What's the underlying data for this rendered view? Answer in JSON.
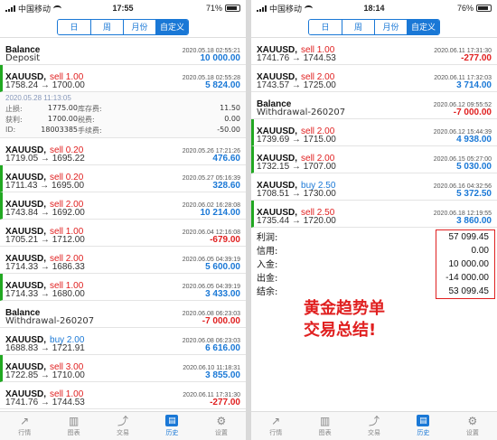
{
  "status_left": {
    "carrier": "中国移动",
    "time": "17:55",
    "battery": "71%",
    "battery_level": 0.71
  },
  "status_right": {
    "carrier": "中国移动",
    "time": "18:14",
    "battery": "76%",
    "battery_level": 0.76
  },
  "segments": [
    "日",
    "周",
    "月份",
    "自定义"
  ],
  "active_segment": "自定义",
  "left_rows": [
    {
      "kind": "balance",
      "title": "Balance",
      "date": "2020.05.18 02:55:21",
      "desc": "Deposit",
      "pl": "10 000.00",
      "sign": "pos",
      "mark": false
    },
    {
      "kind": "trade",
      "symbol": "XAUUSD,",
      "side": "sell",
      "lots": "sell 1.00",
      "date": "2020.05.18 02:55:28",
      "price": "1758.24 → 1700.00",
      "pl": "5 824.00",
      "sign": "pos",
      "mark": true
    },
    {
      "kind": "detail",
      "time": "2020.05.28 11:13:05",
      "items": [
        {
          "k": "止损:",
          "v": "1775.00",
          "k2": "库存费:",
          "v2": "11.50"
        },
        {
          "k": "获利:",
          "v": "1700.00",
          "k2": "税费:",
          "v2": "0.00"
        },
        {
          "k": "ID:",
          "v": "18003385",
          "k2": "手续费:",
          "v2": "-50.00"
        }
      ]
    },
    {
      "kind": "trade",
      "symbol": "XAUUSD,",
      "side": "sell",
      "lots": "sell 0.20",
      "date": "2020.05.26 17:21:26",
      "price": "1719.05 → 1695.22",
      "pl": "476.60",
      "sign": "pos",
      "mark": false
    },
    {
      "kind": "trade",
      "symbol": "XAUUSD,",
      "side": "sell",
      "lots": "sell 0.20",
      "date": "2020.05.27 05:16:39",
      "price": "1711.43 → 1695.00",
      "pl": "328.60",
      "sign": "pos",
      "mark": true
    },
    {
      "kind": "trade",
      "symbol": "XAUUSD,",
      "side": "sell",
      "lots": "sell 2.00",
      "date": "2020.06.02 16:28:08",
      "price": "1743.84 → 1692.00",
      "pl": "10 214.00",
      "sign": "pos",
      "mark": true
    },
    {
      "kind": "trade",
      "symbol": "XAUUSD,",
      "side": "sell",
      "lots": "sell 1.00",
      "date": "2020.06.04 12:16:08",
      "price": "1705.21 → 1712.00",
      "pl": "-679.00",
      "sign": "neg",
      "mark": false
    },
    {
      "kind": "trade",
      "symbol": "XAUUSD,",
      "side": "sell",
      "lots": "sell 2.00",
      "date": "2020.06.05 04:39:19",
      "price": "1714.33 → 1686.33",
      "pl": "5 600.00",
      "sign": "pos",
      "mark": false
    },
    {
      "kind": "trade",
      "symbol": "XAUUSD,",
      "side": "sell",
      "lots": "sell 1.00",
      "date": "2020.06.05 04:39:19",
      "price": "1714.33 → 1680.00",
      "pl": "3 433.00",
      "sign": "pos",
      "mark": true
    },
    {
      "kind": "balance",
      "title": "Balance",
      "date": "2020.06.08 06:23:03",
      "desc": "Withdrawal-260207",
      "pl": "-7 000.00",
      "sign": "neg",
      "mark": false
    },
    {
      "kind": "trade",
      "symbol": "XAUUSD,",
      "side": "buy",
      "lots": "buy 2.00",
      "date": "2020.06.08 06:23:03",
      "price": "1688.83 → 1721.91",
      "pl": "6 616.00",
      "sign": "pos",
      "mark": false
    },
    {
      "kind": "trade",
      "symbol": "XAUUSD,",
      "side": "sell",
      "lots": "sell 3.00",
      "date": "2020.06.10 11:18:31",
      "price": "1722.85 → 1710.00",
      "pl": "3 855.00",
      "sign": "pos",
      "mark": true
    },
    {
      "kind": "trade",
      "symbol": "XAUUSD,",
      "side": "sell",
      "lots": "sell 1.00",
      "date": "2020.06.11 17:31:30",
      "price": "1741.76 → 1744.53",
      "pl": "-277.00",
      "sign": "neg",
      "mark": false
    }
  ],
  "right_rows": [
    {
      "kind": "trade",
      "symbol": "XAUUSD,",
      "side": "sell",
      "lots": "sell 1.00",
      "date": "2020.06.11 17:31:30",
      "price": "1741.76 → 1744.53",
      "pl": "-277.00",
      "sign": "neg",
      "mark": false
    },
    {
      "kind": "trade",
      "symbol": "XAUUSD,",
      "side": "sell",
      "lots": "sell 2.00",
      "date": "2020.06.11 17:32:03",
      "price": "1743.57 → 1725.00",
      "pl": "3 714.00",
      "sign": "pos",
      "mark": false
    },
    {
      "kind": "balance",
      "title": "Balance",
      "date": "2020.06.12 09:55:52",
      "desc": "Withdrawal-260207",
      "pl": "-7 000.00",
      "sign": "neg",
      "mark": false
    },
    {
      "kind": "trade",
      "symbol": "XAUUSD,",
      "side": "sell",
      "lots": "sell 2.00",
      "date": "2020.06.12 15:44:39",
      "price": "1739.69 → 1715.00",
      "pl": "4 938.00",
      "sign": "pos",
      "mark": true
    },
    {
      "kind": "trade",
      "symbol": "XAUUSD,",
      "side": "sell",
      "lots": "sell 2.00",
      "date": "2020.06.15 05:27:00",
      "price": "1732.15 → 1707.00",
      "pl": "5 030.00",
      "sign": "pos",
      "mark": true
    },
    {
      "kind": "trade",
      "symbol": "XAUUSD,",
      "side": "buy",
      "lots": "buy 2.50",
      "date": "2020.06.16 04:32:56",
      "price": "1708.51 → 1730.00",
      "pl": "5 372.50",
      "sign": "pos",
      "mark": false
    },
    {
      "kind": "trade",
      "symbol": "XAUUSD,",
      "side": "sell",
      "lots": "sell 2.50",
      "date": "2020.06.18 12:19:55",
      "price": "1735.44 → 1720.00",
      "pl": "3 860.00",
      "sign": "pos",
      "mark": true
    }
  ],
  "summary": [
    {
      "label": "利润:",
      "value": "57 099.45"
    },
    {
      "label": "信用:",
      "value": "0.00"
    },
    {
      "label": "入金:",
      "value": "10 000.00"
    },
    {
      "label": "出金:",
      "value": "-14 000.00"
    },
    {
      "label": "结余:",
      "value": "53 099.45"
    }
  ],
  "slogan": [
    "黄金趋势单",
    "交易总结!"
  ],
  "tabs": [
    {
      "label": "行情",
      "icon": "quotes-icon",
      "glyph": "↗"
    },
    {
      "label": "图表",
      "icon": "chart-icon",
      "glyph": "▥"
    },
    {
      "label": "交易",
      "icon": "trade-icon",
      "glyph": "⤴"
    },
    {
      "label": "历史",
      "icon": "history-icon",
      "glyph": "▤"
    },
    {
      "label": "设置",
      "icon": "settings-icon",
      "glyph": "⚙"
    }
  ],
  "active_tab": "历史",
  "colors": {
    "accent": "#1a78d6",
    "loss": "#e02020",
    "mark": "#22a822"
  }
}
